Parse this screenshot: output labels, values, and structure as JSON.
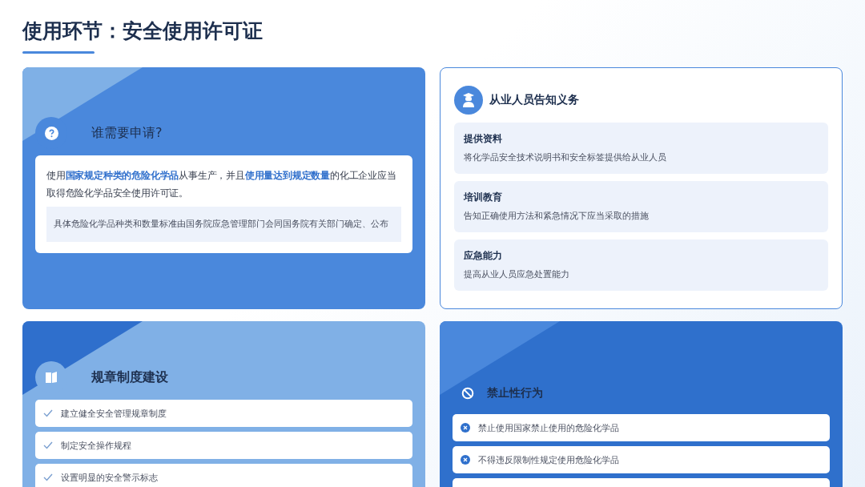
{
  "title": "使用环节：安全使用许可证",
  "cards": [
    {
      "kind": "info",
      "heading": "谁需要申请?",
      "text": "使用**国家规定种类的危险化学品**从事生产，并且**使用量达到规定数量**的化工企业应当取得危险化学品安全使用许可证。",
      "note": "具体危险化学品种类和数量标准由国务院应急管理部门会同国务院有关部门确定、公布"
    },
    {
      "kind": "duties",
      "heading": "从业人员告知义务",
      "items": [
        {
          "title": "提供资料",
          "desc": "将化学品安全技术说明书和安全标签提供给从业人员"
        },
        {
          "title": "培训教育",
          "desc": "告知正确使用方法和紧急情况下应当采取的措施"
        },
        {
          "title": "应急能力",
          "desc": "提高从业人员应急处置能力"
        }
      ]
    },
    {
      "kind": "checklist",
      "heading": "规章制度建设",
      "items": [
        "建立健全安全管理规章制度",
        "制定安全操作规程",
        "设置明显的安全警示标志"
      ]
    },
    {
      "kind": "prohibited",
      "heading": "禁止性行为",
      "items": [
        "禁止使用国家禁止使用的危险化学品",
        "不得违反限制性规定使用危险化学品"
      ]
    }
  ]
}
